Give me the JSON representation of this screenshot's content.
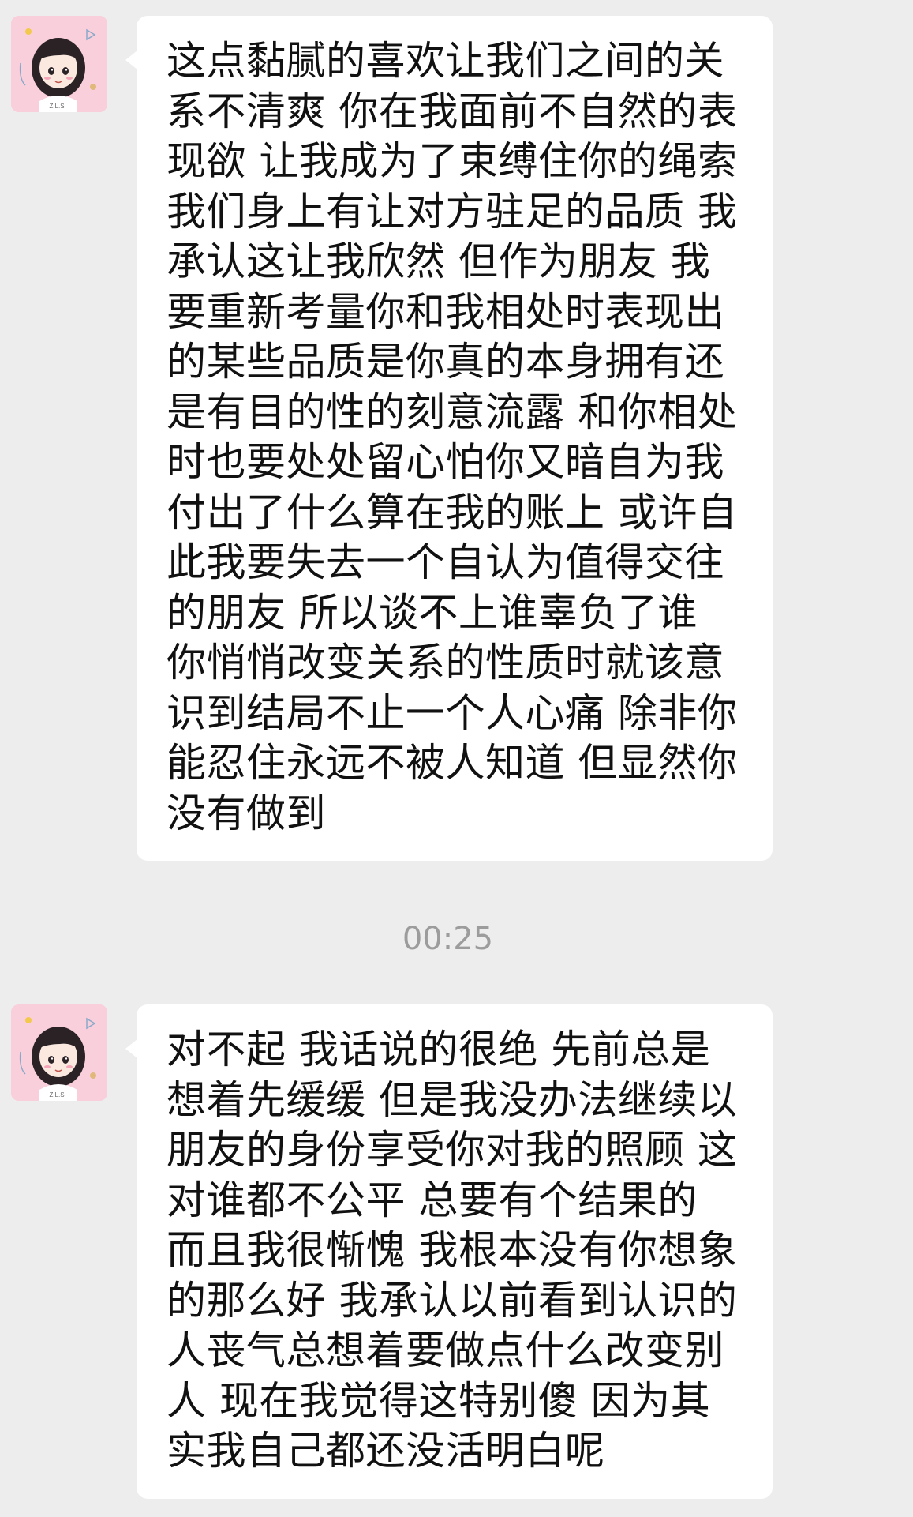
{
  "messages": [
    {
      "sender": "other",
      "avatar": {
        "icon": "girl-avatar-icon",
        "caption": "Z.L.S",
        "bg_color": "#f9cfdc"
      },
      "text": "这点黏腻的喜欢让我们之间的关系不清爽 你在我面前不自然的表现欲 让我成为了束缚住你的绳索 我们身上有让对方驻足的品质 我承认这让我欣然 但作为朋友 我要重新考量你和我相处时表现出的某些品质是你真的本身拥有还是有目的性的刻意流露 和你相处时也要处处留心怕你又暗自为我付出了什么算在我的账上 或许自此我要失去一个自认为值得交往的朋友 所以谈不上谁辜负了谁 你悄悄改变关系的性质时就该意识到结局不止一个人心痛 除非你能忍住永远不被人知道 但显然你没有做到"
    },
    {
      "sender": "other",
      "avatar": {
        "icon": "girl-avatar-icon",
        "caption": "Z.L.S",
        "bg_color": "#f9cfdc"
      },
      "text": "对不起 我话说的很绝 先前总是想着先缓缓 但是我没办法继续以朋友的身份享受你对我的照顾 这对谁都不公平 总要有个结果的 而且我很惭愧 我根本没有你想象的那么好 我承认以前看到认识的人丧气总想着要做点什么改变别人 现在我觉得这特别傻 因为其实我自己都还没活明白呢"
    }
  ],
  "timestamp": "00:25",
  "colors": {
    "chat_background": "#ededed",
    "bubble_background": "#ffffff",
    "timestamp_text": "#9c9c9c",
    "message_text": "#111111"
  }
}
